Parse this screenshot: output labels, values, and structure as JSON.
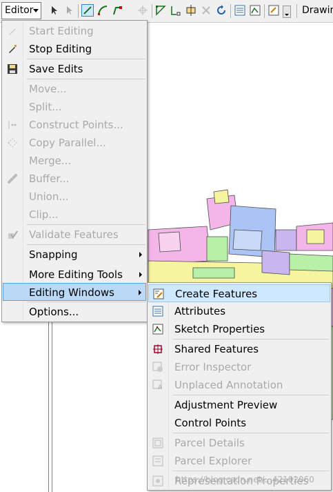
{
  "toolbar": {
    "editor_label": "Editor",
    "drawing_label": "Drawin"
  },
  "editor_menu": {
    "items": [
      {
        "label": "Start Editing",
        "enabled": false,
        "icon": "pencil-start-icon"
      },
      {
        "label": "Stop Editing",
        "enabled": true,
        "icon": "pencil-stop-icon"
      },
      {
        "label": "Save Edits",
        "enabled": true,
        "icon": "save-edits-icon"
      },
      {
        "label": "Move...",
        "enabled": false
      },
      {
        "label": "Split...",
        "enabled": false
      },
      {
        "label": "Construct Points...",
        "enabled": false,
        "icon": "construct-points-icon"
      },
      {
        "label": "Copy Parallel...",
        "enabled": false,
        "icon": "copy-parallel-icon"
      },
      {
        "label": "Merge...",
        "enabled": false
      },
      {
        "label": "Buffer...",
        "enabled": false,
        "icon": "buffer-icon"
      },
      {
        "label": "Union...",
        "enabled": false
      },
      {
        "label": "Clip...",
        "enabled": false
      },
      {
        "label": "Validate Features",
        "enabled": false,
        "icon": "validate-features-icon"
      },
      {
        "label": "Snapping",
        "enabled": true,
        "submenu": true
      },
      {
        "label": "More Editing Tools",
        "enabled": true,
        "submenu": true
      },
      {
        "label": "Editing Windows",
        "enabled": true,
        "submenu": true,
        "highlighted": true
      },
      {
        "label": "Options...",
        "enabled": true
      }
    ]
  },
  "editing_windows_menu": {
    "items": [
      {
        "label": "Create Features",
        "enabled": true,
        "highlighted": true,
        "icon": "create-features-icon"
      },
      {
        "label": "Attributes",
        "enabled": true,
        "icon": "attributes-icon"
      },
      {
        "label": "Sketch Properties",
        "enabled": true,
        "icon": "sketch-properties-icon"
      },
      {
        "label": "Shared Features",
        "enabled": true,
        "icon": "shared-features-icon"
      },
      {
        "label": "Error Inspector",
        "enabled": false,
        "icon": "error-inspector-icon"
      },
      {
        "label": "Unplaced Annotation",
        "enabled": false,
        "icon": "unplaced-annotation-icon"
      },
      {
        "label": "Adjustment Preview",
        "enabled": true
      },
      {
        "label": "Control Points",
        "enabled": true
      },
      {
        "label": "Parcel Details",
        "enabled": false,
        "icon": "parcel-details-icon"
      },
      {
        "label": "Parcel Explorer",
        "enabled": false,
        "icon": "parcel-explorer-icon"
      },
      {
        "label": "Representation Properties",
        "enabled": false,
        "icon": "representation-properties-icon"
      }
    ]
  },
  "watermark": "https://blog.csdn.net/...42102060",
  "colors": {
    "menu_bg": "#f0f0f0",
    "highlight_bg": "#cde8ff",
    "disabled_text": "#a9a9a9",
    "parcel_pink": "#f4b6e8",
    "parcel_green": "#b8f0a8",
    "parcel_blue": "#a9c4f5",
    "parcel_yellow": "#f5f5a0",
    "parcel_lavender": "#c9b6f0"
  }
}
